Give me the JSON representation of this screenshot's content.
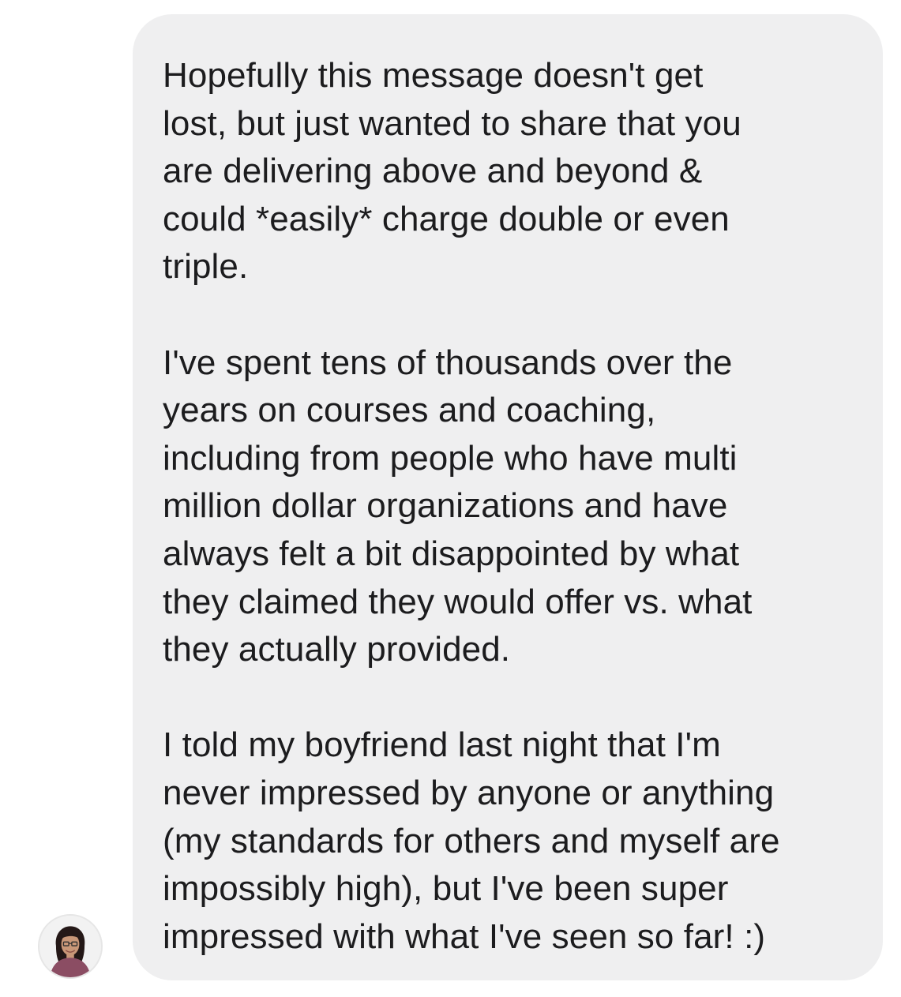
{
  "conversation": {
    "message": {
      "paragraphs": [
        {
          "lines": [
            "Hopefully this message doesn't get",
            "lost, but just wanted to share that you",
            "are delivering above and beyond &",
            "could *easily* charge double or even",
            "triple."
          ]
        },
        {
          "lines": [
            "I've spent tens of thousands over the",
            "years on courses and coaching,",
            "including from people who have multi",
            "million dollar organizations and have",
            "always felt a bit disappointed by what",
            "they claimed they would offer vs. what",
            "they actually provided."
          ]
        },
        {
          "lines": [
            "I told my boyfriend last night that I'm",
            "never impressed by anyone or anything",
            "(my standards for others and myself are",
            "impossibly high), but I've been super",
            "impressed with what I've seen so far! :)"
          ]
        }
      ],
      "bubble_color": "#efeff0",
      "text_color": "#1c1c1e"
    },
    "sender": {
      "avatar_icon": "profile-photo-icon"
    }
  }
}
